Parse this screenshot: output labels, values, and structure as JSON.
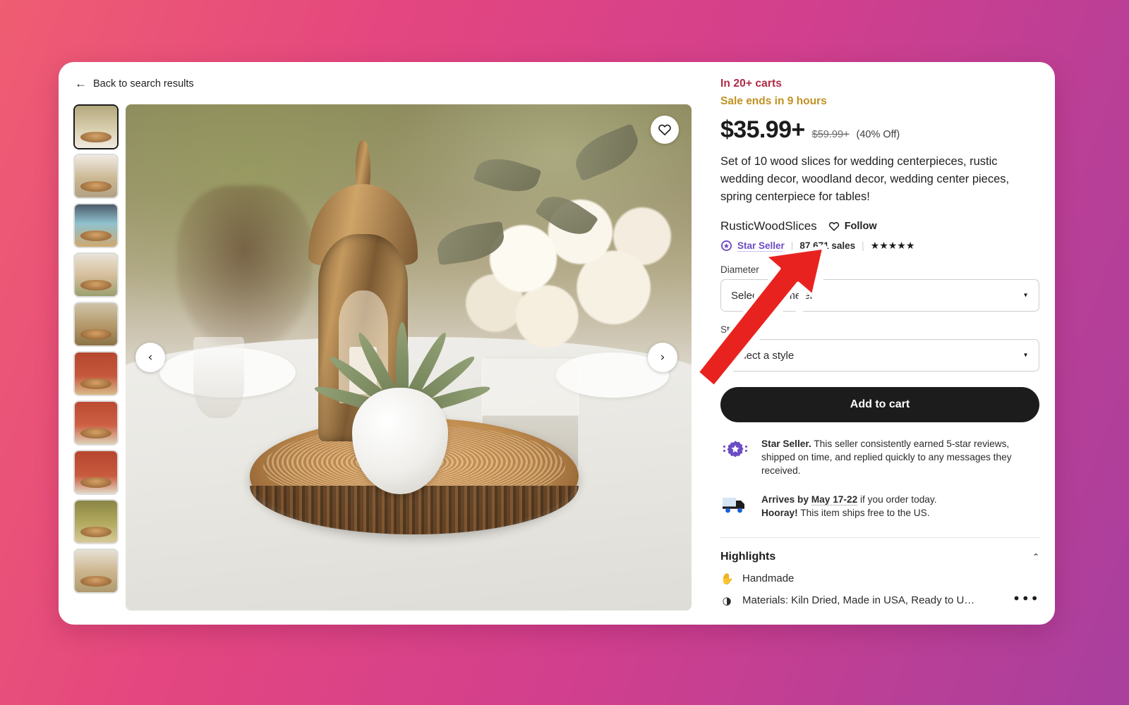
{
  "back": {
    "label": "Back to search results",
    "icon": "arrow-left-icon",
    "glyph": "←"
  },
  "gallery": {
    "prev_glyph": "‹",
    "next_glyph": "›",
    "favorite_icon": "heart-icon",
    "thumbnails": [
      {
        "name": "thumbnail-1",
        "alt": "Wedding table with lantern on wood slice",
        "cls": "t-a",
        "active": true
      },
      {
        "name": "thumbnail-2",
        "alt": "Close up of wood slice",
        "cls": "t-b",
        "active": false
      },
      {
        "name": "thumbnail-3",
        "alt": "Greenery centerpiece on wood slice",
        "cls": "t-c",
        "active": false
      },
      {
        "name": "thumbnail-4",
        "alt": "Wood slice on chair",
        "cls": "t-d",
        "active": false
      },
      {
        "name": "thumbnail-5",
        "alt": "Candles on wood slice",
        "cls": "t-e",
        "active": false
      },
      {
        "name": "thumbnail-6",
        "alt": "Floral arrangement on red backdrop",
        "cls": "t-f",
        "active": false
      },
      {
        "name": "thumbnail-7",
        "alt": "Vase with flowers on wood slice",
        "cls": "t-g",
        "active": false
      },
      {
        "name": "thumbnail-8",
        "alt": "Lantern with flowers on red backdrop",
        "cls": "t-h",
        "active": false
      },
      {
        "name": "thumbnail-9",
        "alt": "Green foliage centerpiece",
        "cls": "t-i",
        "active": false
      },
      {
        "name": "thumbnail-10",
        "alt": "Candle holder on wood slice",
        "cls": "t-j",
        "active": false
      }
    ],
    "main_image_alt": "Rustic wedding centerpiece: bronze lantern, succulent and hydrangeas on a wood slice"
  },
  "listing": {
    "carts_badge": "In 20+ carts",
    "sale_banner": "Sale ends in 9 hours",
    "price": "$35.99+",
    "original_price": "$59.99+",
    "discount": "(40% Off)",
    "title": "Set of 10 wood slices for wedding centerpieces, rustic wedding decor, woodland decor, wedding center pieces, spring centerpiece for tables!"
  },
  "shop": {
    "name": "RusticWoodSlices",
    "follow_label": "Follow",
    "follow_icon": "heart-outline-icon",
    "star_seller_badge": "Star Seller",
    "star_seller_icon": "star-seller-badge-icon",
    "sales": "87,671 sales",
    "divider": "|",
    "rating_stars": "★★★★★",
    "rating_count": 5
  },
  "options": [
    {
      "label": "Diameter",
      "required": false,
      "value": "Select a diameter",
      "caret": "▾",
      "name": "diameter"
    },
    {
      "label": "Style",
      "required": true,
      "value": "Select a style",
      "caret": "▾",
      "name": "style"
    }
  ],
  "cta": {
    "add_to_cart": "Add to cart"
  },
  "badges": {
    "star_seller": {
      "icon": "star-seller-badge-icon",
      "bold": "Star Seller.",
      "text": " This seller consistently earned 5-star reviews, shipped on time, and replied quickly to any messages they received."
    },
    "shipping": {
      "icon": "delivery-truck-icon",
      "line1_prefix": "Arrives by ",
      "line1_date": "May 17-22",
      "line1_suffix": " if you order today.",
      "line2_bold": "Hooray!",
      "line2_text": " This item ships free to the US."
    }
  },
  "highlights": {
    "title": "Highlights",
    "collapse_caret": "⌃",
    "items": [
      {
        "icon": "handmade-hand-icon",
        "glyph": "✋",
        "text": "Handmade"
      },
      {
        "icon": "materials-icon",
        "glyph": "◑",
        "text": "Materials: Kiln Dried, Made in USA, Ready to U…"
      }
    ],
    "overflow_glyph": "•••"
  },
  "annotation": {
    "type": "arrow",
    "color": "#e8231f",
    "outline": "#ffffff",
    "points_at": "87,671 sales"
  },
  "colors": {
    "accent_sale": "#c29123",
    "accent_carts": "#b02a45",
    "star_seller_purple": "#6b4cc4",
    "cta_background": "#1c1c1c",
    "page_gradient_start": "#ef5d72",
    "page_gradient_end": "#a93f9e"
  }
}
